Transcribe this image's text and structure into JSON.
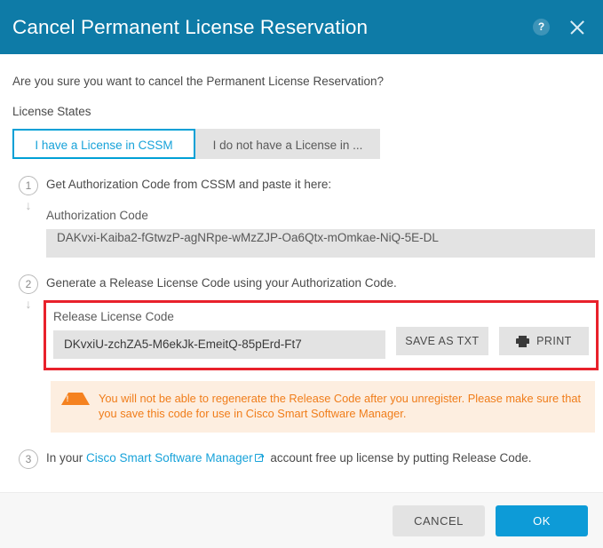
{
  "header": {
    "title": "Cancel Permanent License Reservation",
    "help_icon": "help-circle-icon",
    "help_glyph": "?",
    "close_icon": "close-icon",
    "background_color": "#0e7ba7"
  },
  "body": {
    "intro_text": "Are you sure you want to cancel the Permanent License Reservation?",
    "license_states_label": "License States",
    "toggle": {
      "selected_index": 0,
      "options": [
        {
          "label": "I have a License in CSSM",
          "selected": true
        },
        {
          "label": "I do not have a License in ...",
          "selected": false
        }
      ]
    },
    "steps": [
      {
        "number": "1",
        "arrow": "↓",
        "title": "Get Authorization Code from CSSM and paste it here:",
        "field_label": "Authorization Code",
        "field_value": "DAKvxi-Kaiba2-fGtwzP-agNRpe-wMzZJP-Oa6Qtx-mOmkae-NiQ-5E-DL"
      },
      {
        "number": "2",
        "arrow": "↓",
        "title": "Generate a Release License Code using your Authorization Code.",
        "field_label": "Release License Code",
        "field_value": "DKvxiU-zchZA5-M6ekJk-EmeitQ-85pErd-Ft7",
        "save_button_label": "SAVE AS TXT",
        "print_button_label": "PRINT",
        "print_icon": "printer-icon",
        "highlight_color": "#e8212b"
      },
      {
        "number": "3",
        "title_before_link": "In your ",
        "link_label": "Cisco Smart Software Manager",
        "link_icon": "external-link-icon",
        "title_after_link": " account free up license by putting Release Code.",
        "link_color": "#17a2d9"
      }
    ],
    "warning": {
      "icon": "warning-triangle-icon",
      "text": "You will not be able to regenerate the Release Code after you unregister. Please make sure that you save this code for use in Cisco Smart Software Manager.",
      "text_color": "#f07d1a",
      "background_color": "#fdeee0"
    }
  },
  "footer": {
    "cancel_label": "CANCEL",
    "ok_label": "OK",
    "ok_color": "#0d9bd7"
  }
}
